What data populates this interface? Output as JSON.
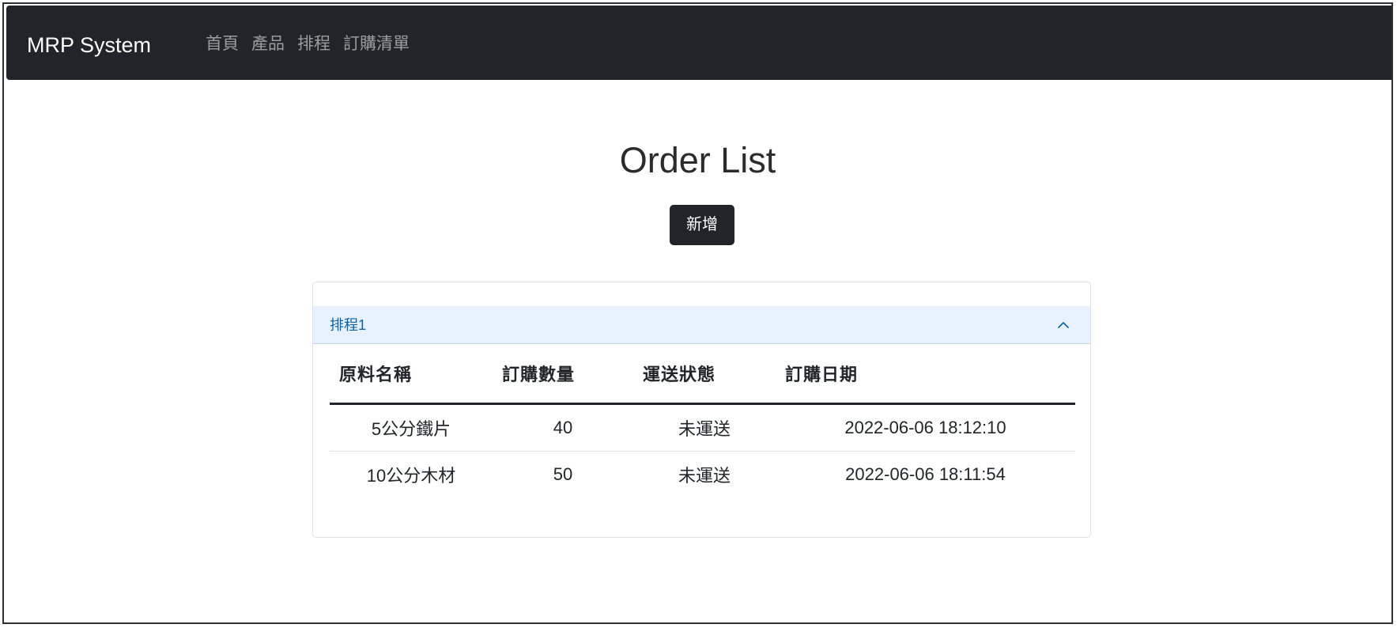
{
  "navbar": {
    "brand": "MRP System",
    "links": [
      "首頁",
      "產品",
      "排程",
      "訂購清單"
    ]
  },
  "page": {
    "title": "Order List",
    "add_button_label": "新增"
  },
  "accordion": {
    "title": "排程1",
    "expanded": true,
    "table": {
      "columns": [
        "原料名稱",
        "訂購數量",
        "運送狀態",
        "訂購日期"
      ],
      "rows": [
        [
          "5公分鐵片",
          "40",
          "未運送",
          "2022-06-06 18:12:10"
        ],
        [
          "10公分木材",
          "50",
          "未運送",
          "2022-06-06 18:11:54"
        ]
      ]
    }
  },
  "icons": {
    "accordion_toggle": "chevron-up-icon"
  },
  "colors": {
    "navbar_bg": "#212529",
    "accordion_header_bg": "#e7f1ff",
    "accordion_title": "#0c63a4",
    "button_bg": "#212529"
  }
}
